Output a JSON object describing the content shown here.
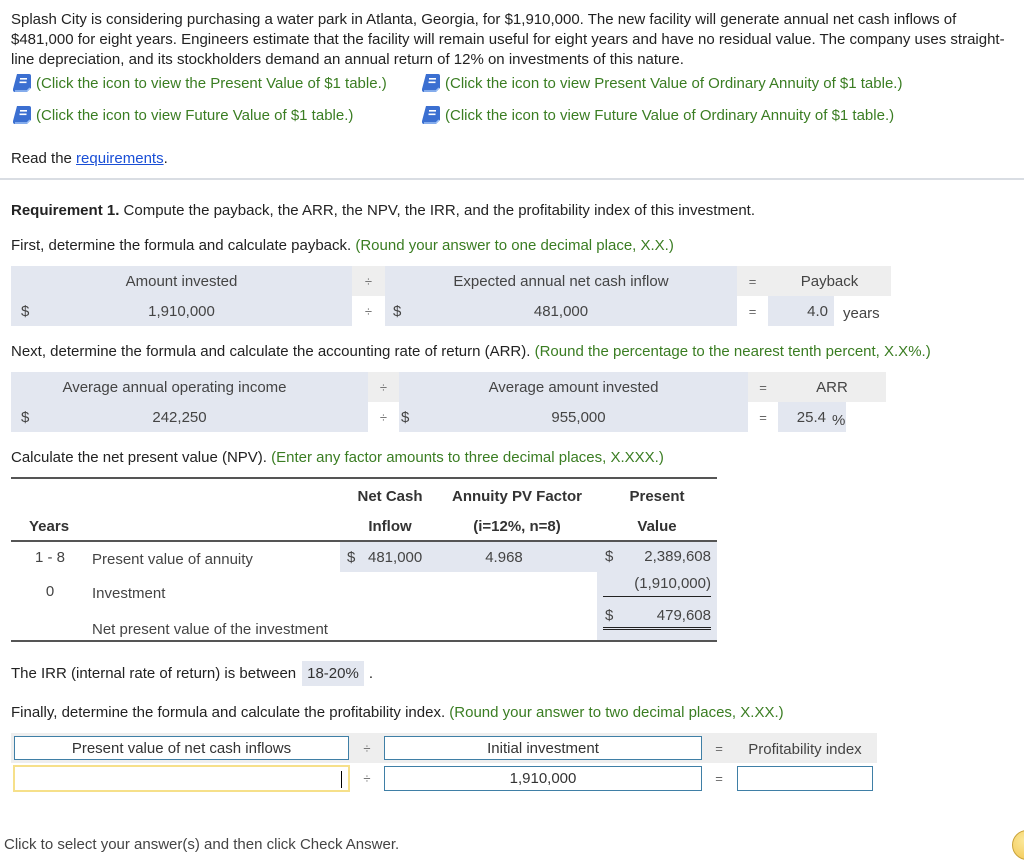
{
  "problem": {
    "text": "Splash City is considering purchasing a water park in Atlanta, Georgia, for $1,910,000. The new facility will generate annual net cash inflows of $481,000 for eight years. Engineers estimate that the facility will remain useful for eight years and have no residual value. The company uses straight-line depreciation, and its stockholders demand an annual return of 12% on investments of this nature.",
    "links": [
      {
        "icon": "book-icon",
        "label": "(Click the icon to view the Present Value of $1 table.)"
      },
      {
        "icon": "book-icon",
        "label": "(Click the icon to view Present Value of Ordinary Annuity of $1 table.)"
      },
      {
        "icon": "book-icon",
        "label": "(Click the icon to view Future Value of $1 table.)"
      },
      {
        "icon": "book-icon",
        "label": "(Click the icon to view Future Value of Ordinary Annuity of $1 table.)"
      }
    ],
    "read_prefix": "Read the ",
    "read_link": "requirements",
    "read_suffix": "."
  },
  "requirement1": {
    "title_bold": "Requirement 1.",
    "title_rest": " Compute the payback, the ARR, the NPV, the IRR, and the profitability index of this investment."
  },
  "payback": {
    "instruction": "First, determine the formula and calculate payback.",
    "hint": "(Round your answer to one decimal place, X.X.)",
    "header": {
      "left": "Amount invested",
      "op1": "÷",
      "middle": "Expected annual net cash inflow",
      "op2": "=",
      "result": "Payback"
    },
    "row": {
      "cur1": "$",
      "left": "1,910,000",
      "op1": "÷",
      "cur2": "$",
      "middle": "481,000",
      "op2": "=",
      "result": "4.0",
      "unit": "years"
    }
  },
  "arr": {
    "instruction": "Next, determine the formula and calculate the accounting rate of return (ARR).",
    "hint": "(Round the percentage to the nearest tenth percent, X.X%.)",
    "header": {
      "left": "Average annual operating income",
      "op1": "÷",
      "middle": "Average amount invested",
      "op2": "=",
      "result": "ARR"
    },
    "row": {
      "cur1": "$",
      "left": "242,250",
      "op1": "÷",
      "cur2": "$",
      "middle": "955,000",
      "op2": "=",
      "result": "25.4",
      "unit": "%"
    }
  },
  "npv": {
    "instruction": "Calculate the net present value (NPV).",
    "hint": "(Enter any factor amounts to three decimal places, X.XXX.)",
    "headers": {
      "years": "Years",
      "net_cash_1": "Net Cash",
      "net_cash_2": "Inflow",
      "factor_1": "Annuity PV Factor",
      "factor_2": "(i=12%, n=8)",
      "pv_1": "Present",
      "pv_2": "Value"
    },
    "rows": [
      {
        "years": "1 - 8",
        "label": "Present value of annuity",
        "cur": "$",
        "inflow": "481,000",
        "factor": "4.968",
        "pv_cur": "$",
        "pv": "2,389,608"
      },
      {
        "years": "0",
        "label": "Investment",
        "pv": "(1,910,000)"
      },
      {
        "label": "Net present value of the investment",
        "pv_cur": "$",
        "pv": "479,608"
      }
    ]
  },
  "irr": {
    "prefix": "The IRR (internal rate of return) is between",
    "value": "18-20%",
    "suffix": "."
  },
  "pi": {
    "instruction": "Finally, determine the formula and calculate the profitability index.",
    "hint": "(Round your answer to two decimal places, X.XX.)",
    "header": {
      "left": "Present value of net cash inflows",
      "op1": "÷",
      "middle": "Initial investment",
      "op2": "=",
      "result": "Profitability index"
    },
    "row": {
      "left": "",
      "op1": "÷",
      "middle": "1,910,000",
      "op2": "=",
      "result": ""
    }
  },
  "footer": {
    "text": "Click to select your answer(s) and then click Check Answer."
  }
}
